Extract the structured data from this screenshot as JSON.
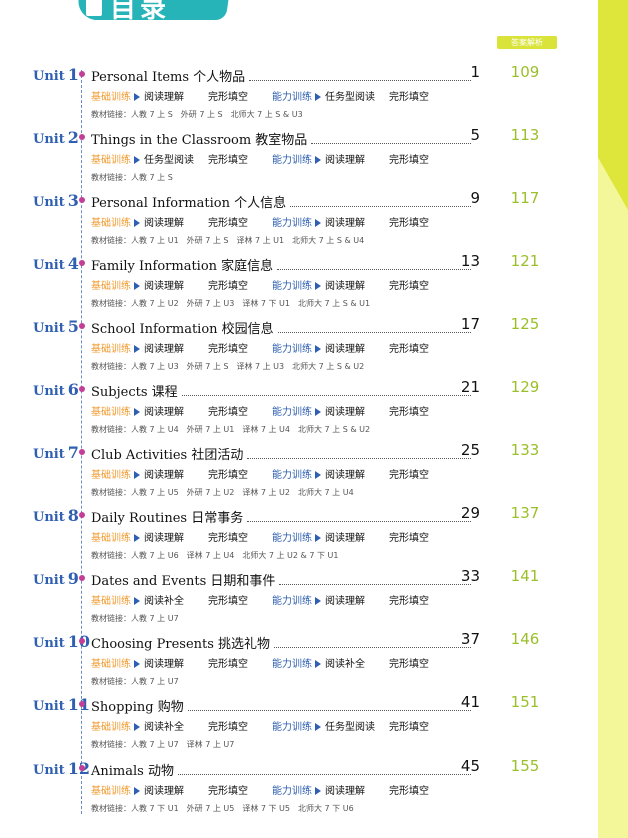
{
  "header": {
    "title": "目录",
    "answer_label": "答案解析"
  },
  "labels": {
    "basic": "基础训练",
    "ability": "能力训练",
    "link": "教材链接：",
    "unit": "Unit"
  },
  "units": [
    {
      "num": "1",
      "title": "Personal Items 个人物品",
      "page": "1",
      "answer": "109",
      "b1": "阅读理解",
      "b2": "完形填空",
      "a1": "任务型阅读",
      "a2": "完形填空",
      "link": "人教 7 上 S　外研 7 上 S　北师大 7 上 S & U3"
    },
    {
      "num": "2",
      "title": "Things in the Classroom 教室物品",
      "page": "5",
      "answer": "113",
      "b1": "任务型阅读",
      "b2": "完形填空",
      "a1": "阅读理解",
      "a2": "完形填空",
      "link": "人教 7 上 S"
    },
    {
      "num": "3",
      "title": "Personal Information 个人信息",
      "page": "9",
      "answer": "117",
      "b1": "阅读理解",
      "b2": "完形填空",
      "a1": "阅读理解",
      "a2": "完形填空",
      "link": "人教 7 上 U1　外研 7 上 S　译林 7 上 U1　北师大 7 上 S & U4"
    },
    {
      "num": "4",
      "title": "Family Information 家庭信息",
      "page": "13",
      "answer": "121",
      "b1": "阅读理解",
      "b2": "完形填空",
      "a1": "阅读理解",
      "a2": "完形填空",
      "link": "人教 7 上 U2　外研 7 上 U3　译林 7 下 U1　北师大 7 上 S & U1"
    },
    {
      "num": "5",
      "title": "School Information 校园信息",
      "page": "17",
      "answer": "125",
      "b1": "阅读理解",
      "b2": "完形填空",
      "a1": "阅读理解",
      "a2": "完形填空",
      "link": "人教 7 上 U3　外研 7 上 S　译林 7 上 U3　北师大 7 上 S & U2"
    },
    {
      "num": "6",
      "title": "Subjects 课程",
      "page": "21",
      "answer": "129",
      "b1": "阅读理解",
      "b2": "完形填空",
      "a1": "阅读理解",
      "a2": "完形填空",
      "link": "人教 7 上 U4　外研 7 上 U1　译林 7 上 U4　北师大 7 上 S & U2"
    },
    {
      "num": "7",
      "title": "Club Activities 社团活动",
      "page": "25",
      "answer": "133",
      "b1": "阅读理解",
      "b2": "完形填空",
      "a1": "阅读理解",
      "a2": "完形填空",
      "link": "人教 7 上 U5　外研 7 上 U2　译林 7 上 U2　北师大 7 上 U4"
    },
    {
      "num": "8",
      "title": "Daily Routines 日常事务",
      "page": "29",
      "answer": "137",
      "b1": "阅读理解",
      "b2": "完形填空",
      "a1": "阅读理解",
      "a2": "完形填空",
      "link": "人教 7 上 U6　译林 7 上 U4　北师大 7 上 U2 & 7 下 U1"
    },
    {
      "num": "9",
      "title": "Dates and Events 日期和事件",
      "page": "33",
      "answer": "141",
      "b1": "阅读补全",
      "b2": "完形填空",
      "a1": "阅读理解",
      "a2": "完形填空",
      "link": "人教 7 上 U7"
    },
    {
      "num": "10",
      "title": "Choosing Presents 挑选礼物",
      "page": "37",
      "answer": "146",
      "b1": "阅读理解",
      "b2": "完形填空",
      "a1": "阅读补全",
      "a2": "完形填空",
      "link": "人教 7 上 U7"
    },
    {
      "num": "11",
      "title": "Shopping 购物",
      "page": "41",
      "answer": "151",
      "b1": "阅读补全",
      "b2": "完形填空",
      "a1": "任务型阅读",
      "a2": "完形填空",
      "link": "人教 7 上 U7　译林 7 上 U7"
    },
    {
      "num": "12",
      "title": "Animals 动物",
      "page": "45",
      "answer": "155",
      "b1": "阅读理解",
      "b2": "完形填空",
      "a1": "阅读理解",
      "a2": "完形填空",
      "link": "人教 7 下 U1　外研 7 上 U5　译林 7 下 U5　北师大 7 下 U6"
    }
  ]
}
